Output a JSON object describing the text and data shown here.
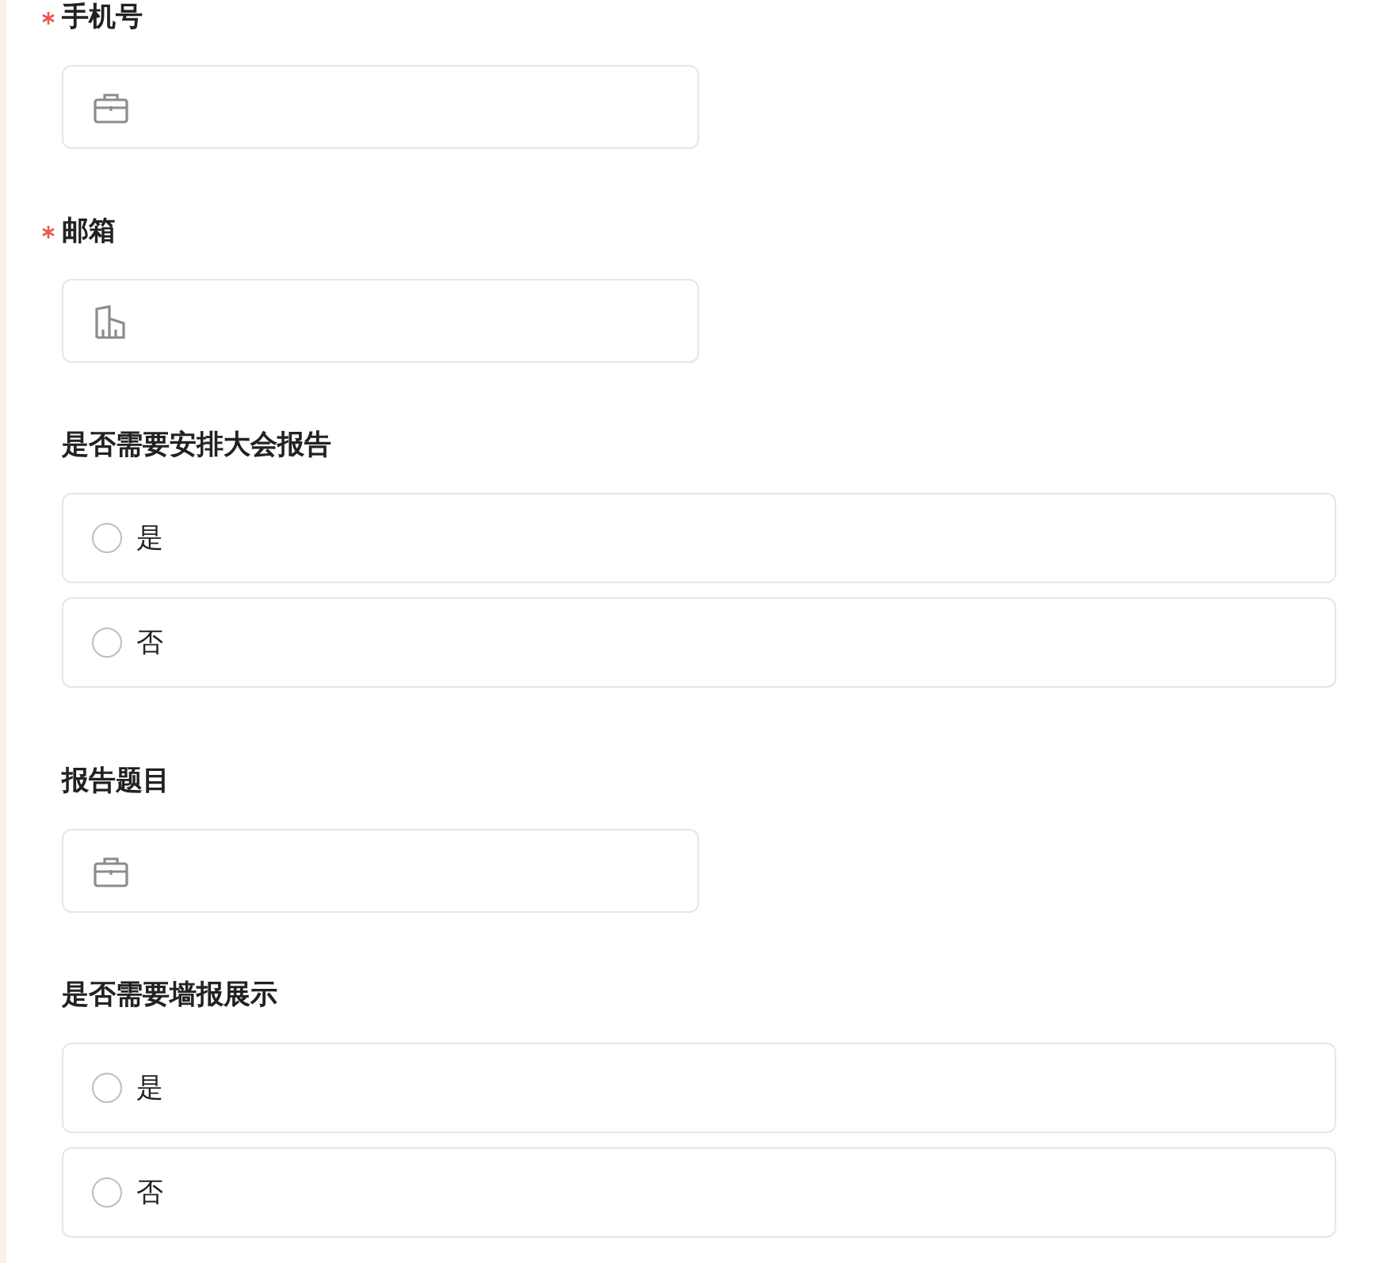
{
  "fields": [
    {
      "kind": "text",
      "label": "手机号",
      "required": true
    },
    {
      "kind": "text",
      "label": "邮箱",
      "required": true
    },
    {
      "kind": "choice",
      "label": "是否需要安排大会报告",
      "required": false,
      "options": [
        {
          "label": "是",
          "selected": false
        },
        {
          "label": "否",
          "selected": false
        }
      ]
    },
    {
      "kind": "text",
      "label": "报告题目",
      "required": false
    },
    {
      "kind": "choice",
      "label": "是否需要墙报展示",
      "required": false,
      "options": [
        {
          "label": "是",
          "selected": false
        },
        {
          "label": "否",
          "selected": false
        }
      ]
    }
  ]
}
